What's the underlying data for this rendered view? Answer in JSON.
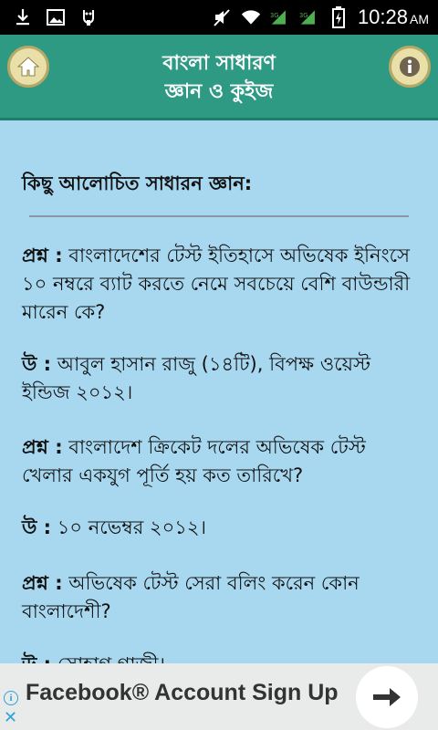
{
  "status_bar": {
    "time": "10:28",
    "ampm": "AM"
  },
  "header": {
    "title_line1": "বাংলা সাধারণ",
    "title_line2": "জ্ঞান ও কুইজ"
  },
  "content": {
    "heading": "কিছু আলোচিত সাধারন জ্ঞান:",
    "items": [
      {
        "label": "প্রশ্ন :",
        "text": " বাংলাদেশের টেস্ট ইতিহাসে অভিষেক ইনিংসে ১০ নম্বরে ব্যাট করতে নেমে সবচেয়ে বেশি বাউন্ডারী মারেন কে?"
      },
      {
        "label": "উ :",
        "text": " আবুল হাসান রাজু (১৪টি), বিপক্ষ ওয়েস্ট ইন্ডিজ ২০১২।"
      },
      {
        "label": "প্রশ্ন :",
        "text": " বাংলাদেশ ক্রিকেট দলের অভিষেক টেস্ট খেলার একযুগ পূর্তি হয় কত তারিখে?"
      },
      {
        "label": "উ :",
        "text": " ১০ নভেম্বর ২০১২।"
      },
      {
        "label": "প্রশ্ন :",
        "text": " অভিষেক টেস্ট সেরা বলিং করেন কোন বাংলাদেশী?"
      },
      {
        "label": "উ :",
        "text": " সোহাগ গাজী।"
      }
    ]
  },
  "ad": {
    "text": "Facebook® Account Sign Up"
  },
  "colors": {
    "header_bg": "#2e9a84",
    "content_bg": "#a8d8f0",
    "ad_bg": "#e9eaea"
  },
  "icons": [
    "download-icon",
    "image-icon",
    "usb-debug-icon",
    "mute-icon",
    "wifi-icon",
    "signal-icon",
    "battery-icon",
    "home-icon",
    "info-icon",
    "arrow-right-icon",
    "close-icon"
  ]
}
